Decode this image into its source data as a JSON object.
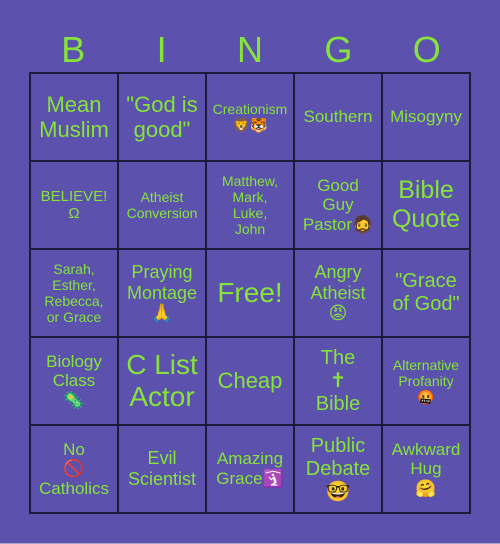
{
  "title_letters": [
    "B",
    "I",
    "N",
    "G",
    "O"
  ],
  "colors": {
    "background": "#5c52ae",
    "text": "#86e33a",
    "grid": "#1e1a3c"
  },
  "cells": [
    [
      "Mean\nMuslim",
      "\"God is\ngood\"",
      "Creationism\n🦁🐯",
      "Southern",
      "Misogyny"
    ],
    [
      "BELIEVE!\nΩ",
      "Atheist\nConversion",
      "Matthew,\nMark,\nLuke,\nJohn",
      "Good\nGuy\nPastor🧔",
      "Bible\nQuote"
    ],
    [
      "Sarah,\nEsther,\nRebecca,\nor Grace",
      "Praying\nMontage\n🙏",
      "Free!",
      "Angry\nAtheist\n😡",
      "\"Grace\nof God\""
    ],
    [
      "Biology\nClass\n🦠",
      "C List\nActor",
      "Cheap",
      "The\n✝\nBible",
      "Alternative\nProfanity\n🤬"
    ],
    [
      "No\n🚫\nCatholics",
      "Evil\nScientist",
      "Amazing\nGrace🛐",
      "Public\nDebate\n🤓",
      "Awkward\nHug\n🤗"
    ]
  ]
}
